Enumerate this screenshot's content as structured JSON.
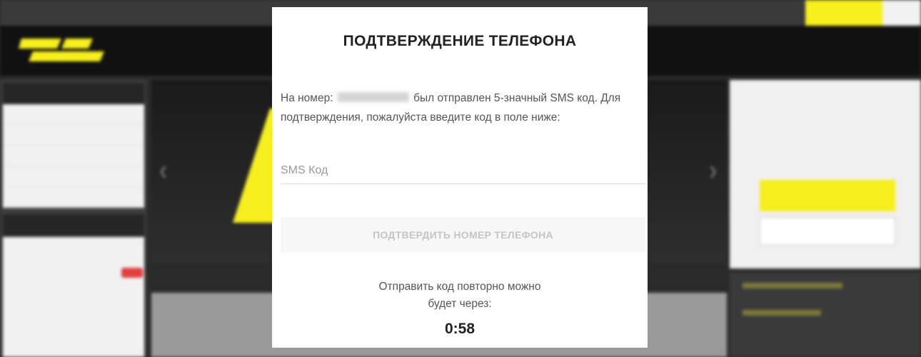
{
  "modal": {
    "title": "ПОДТВЕРЖДЕНИЕ ТЕЛЕФОНА",
    "message_before_number": "На номер:",
    "message_after_number": "был отправлен 5-значный SMS код. Для подтверждения, пожалуйста введите код в поле ниже:",
    "code_input_placeholder": "SMS Код",
    "confirm_button_label": "ПОДТВЕРДИТЬ НОМЕР ТЕЛЕФОНА",
    "resend_line1": "Отправить код повторно можно",
    "resend_line2": "будет через:",
    "timer": "0:58"
  },
  "colors": {
    "brand_yellow": "#f7ef1e",
    "modal_bg": "#ffffff",
    "button_disabled_bg": "#f7f7f7",
    "button_disabled_text": "#c5c5c5"
  },
  "icons": [
    "left-arrow-icon",
    "right-arrow-icon",
    "logo"
  ]
}
